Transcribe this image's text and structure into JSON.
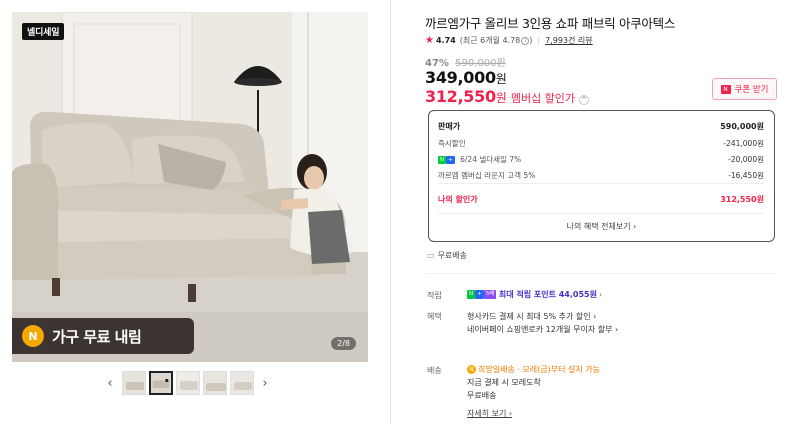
{
  "gallery": {
    "tag": "넬디세일",
    "promo_coin": "N",
    "promo_text": "가구 무료 내림",
    "page_indicator": "2/8",
    "prev_arrow": "‹",
    "next_arrow": "›",
    "thumb_count": 5,
    "active_thumb": 2
  },
  "product": {
    "title": "까르엠가구 올리브 3인용 쇼파 패브릭 아쿠아텍스",
    "rating_star": "★",
    "rating": "4.74",
    "rating_recent": "(최근 6개월 4.78",
    "rating_recent_close": ")",
    "rating_info_icon": "i",
    "review_count": "7,993건 리뷰",
    "discount_pct": "47%",
    "original_price": "590,000원",
    "price": "349,000",
    "price_unit": "원",
    "member_price": "312,550",
    "member_unit": "원",
    "member_label": "멤버십 할인가",
    "member_toggle": "^",
    "coupon_icon": "N",
    "coupon_label": "쿠폰 받기"
  },
  "benefits": {
    "rows": [
      {
        "label": "판매가",
        "value": "590,000원"
      },
      {
        "label": "즉시할인",
        "value": "-241,000원"
      },
      {
        "badge1": "N",
        "badge2": "+",
        "label": "6/24 넬다세일 7%",
        "value": "-20,000원"
      },
      {
        "label": "까르엠 멤버십 라운지 고객 5%",
        "value": "-16,450원"
      }
    ],
    "my_discount_label": "나의 할인가",
    "my_discount_value": "312,550원",
    "view_all": "나의 혜택 전체보기 ›"
  },
  "shipping_note": {
    "icon": "▭",
    "text": "무료배송"
  },
  "accrual": {
    "label": "적립",
    "badge1": "N",
    "badge2": "+",
    "badge3": "5배",
    "text": "최대 적립 포인트 44,055원",
    "chevron": "›"
  },
  "perks": {
    "label": "혜택",
    "line1": "형사카드 결제 시 최대 5% 추가 할인 ›",
    "line2": "네이버페이 쇼핑앤로카 12개월 무이자 할부 ›"
  },
  "delivery": {
    "label": "배송",
    "badge": "N",
    "line1": "희망일배송 · 모레(금)부터 설치 가능",
    "line2": "지금 결제 시 모레도착",
    "line3": "무료배송",
    "detail_link": "자세히 보기 ›"
  }
}
